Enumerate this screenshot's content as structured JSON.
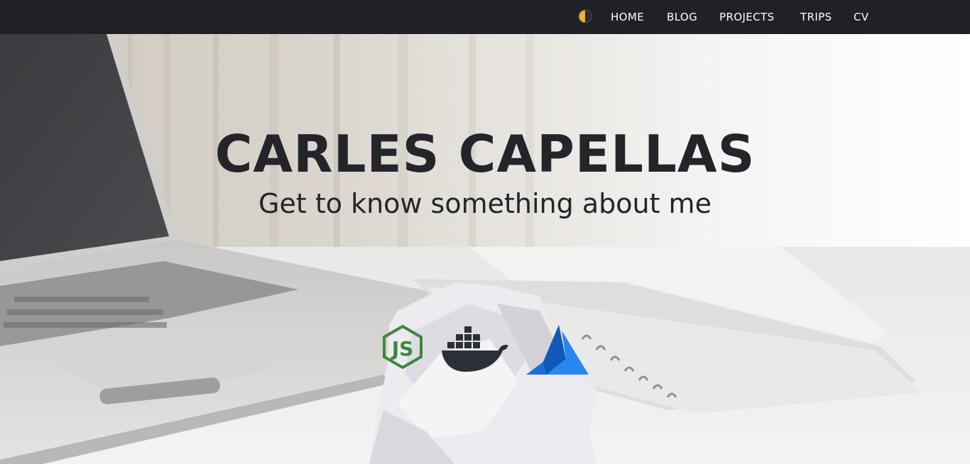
{
  "nav": {
    "theme_toggle_icon": "half-moon-toggle-icon",
    "links": [
      {
        "label": "HOME"
      },
      {
        "label": "BLOG"
      },
      {
        "label": "PROJECTS"
      },
      {
        "label": "TRIPS"
      },
      {
        "label": "CV"
      }
    ]
  },
  "hero": {
    "title": "CARLES CAPELLAS",
    "subtitle": "Get to know something about me",
    "tech_icons": [
      {
        "icon": "nodejs-icon",
        "color": "#3c873a"
      },
      {
        "icon": "docker-icon",
        "color": "#2b3036"
      },
      {
        "icon": "azure-icon",
        "color": "#1a6fd8"
      }
    ]
  },
  "colors": {
    "navbar_bg": "#1f2127",
    "nav_text": "#ffffff",
    "title_text": "#23252a",
    "toggle_yellow": "#f0b429"
  }
}
